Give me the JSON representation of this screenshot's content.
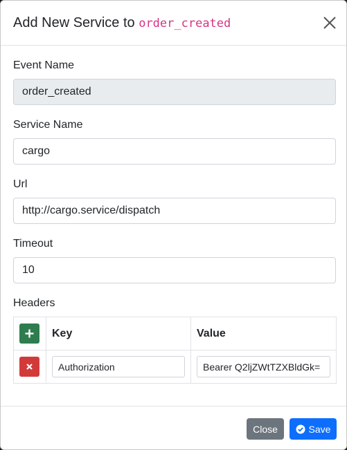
{
  "dialog": {
    "title_prefix": "Add New Service to",
    "title_event": "order_created"
  },
  "form": {
    "event_name": {
      "label": "Event Name",
      "value": "order_created"
    },
    "service_name": {
      "label": "Service Name",
      "value": "cargo"
    },
    "url": {
      "label": "Url",
      "value": "http://cargo.service/dispatch"
    },
    "timeout": {
      "label": "Timeout",
      "value": "10"
    }
  },
  "headers": {
    "label": "Headers",
    "columns": {
      "key": "Key",
      "value": "Value"
    },
    "rows": [
      {
        "key": "Authorization",
        "value": "Bearer Q2ljZWtTZXBldGk="
      }
    ]
  },
  "footer": {
    "close_label": "Close",
    "save_label": "Save"
  },
  "colors": {
    "add_button": "#2f7d4e",
    "remove_button": "#d23a3a",
    "close_button": "#6c757d",
    "save_button": "#0d6efd",
    "event_code": "#d63384"
  },
  "icons": {
    "close": "close-icon",
    "add": "plus-icon",
    "remove": "x-icon",
    "save": "check-circle-icon"
  }
}
